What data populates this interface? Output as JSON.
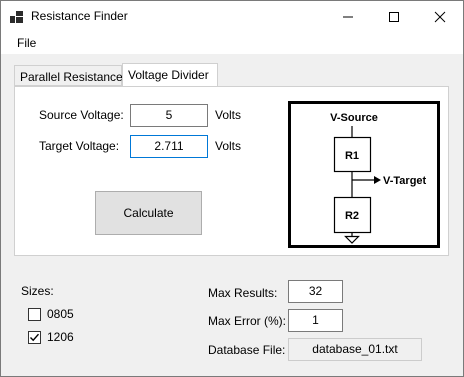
{
  "window": {
    "title": "Resistance Finder"
  },
  "menu": {
    "file": "File"
  },
  "tabs": [
    {
      "label": "Parallel Resistance"
    },
    {
      "label": "Voltage Divider"
    }
  ],
  "divider": {
    "source_label": "Source Voltage:",
    "source_value": "5",
    "source_unit": "Volts",
    "target_label": "Target Voltage:",
    "target_value": "2.711",
    "target_unit": "Volts",
    "calculate_label": "Calculate"
  },
  "circuit": {
    "v_source": "V-Source",
    "r1": "R1",
    "v_target": "V-Target",
    "r2": "R2"
  },
  "sizes": {
    "label": "Sizes:",
    "options": [
      {
        "label": "0805",
        "checked": false
      },
      {
        "label": "1206",
        "checked": true
      }
    ]
  },
  "settings": {
    "max_results_label": "Max Results:",
    "max_results_value": "32",
    "max_error_label": "Max Error (%):",
    "max_error_value": "1",
    "database_label": "Database File:",
    "database_value": "database_01.txt"
  }
}
